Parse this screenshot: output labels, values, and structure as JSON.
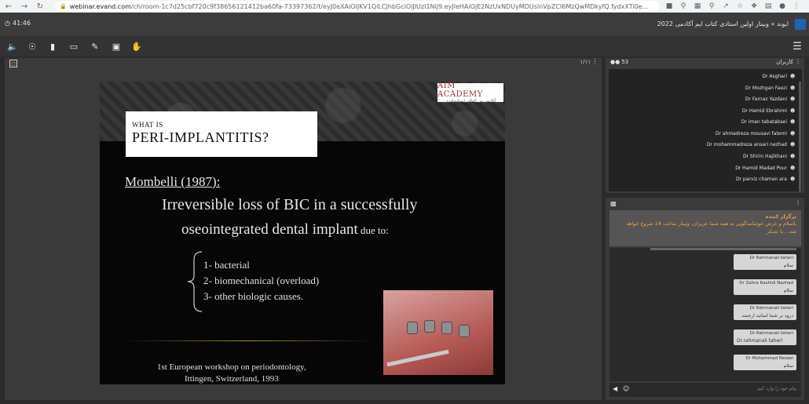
{
  "browser": {
    "url_host": "webinar.evand.com",
    "url_rest": "/ch/room-1c7d25cbf720c9f38656121412ba60fa-73397362/t/eyJ0eXAiOiJKV1QiLCJhbGciOiJIUzI1NiJ9.eyJleHAiOjE2NzUxNDUyMDUsInVpZCI6MzQwMDkyfQ.fydxXTi0e..."
  },
  "header": {
    "timer": "41:46",
    "title": "ایوند » وبینار اولین استادی کتاب ایم آکادمی 2022"
  },
  "stage": {
    "page_num": "۱/۱۱"
  },
  "slide": {
    "logo_name": "AIM ACADEMY",
    "logo_sub": "آکادمی بین المللی ایمپلنتولوژی",
    "title_small": "WHAT IS",
    "title_big": "PERI-IMPLANTITIS?",
    "author": "Mombelli (1987):",
    "line1": "Irreversible loss of BIC in a successfully",
    "line2": "oseointegrated dental implant",
    "line2_suffix": " due to:",
    "causes": [
      "1- bacterial",
      "2- biomechanical (overload)",
      "3- other biologic causes."
    ],
    "ref1": "1st European workshop on periodontology,",
    "ref2": "Ittingen, Switzerland, 1993"
  },
  "users": {
    "count": "53",
    "title": "کاربران",
    "list": [
      "Dr Asghari",
      "Dr Mozhgan Faezi",
      "Dr Farnaz Yazdani",
      "Dr Hamid Ebrahimi",
      "Dr iman tabatabaei",
      "Dr ahmadreza mousavi fatemi",
      "Dr mohammadreza ansari nezhad",
      "Dr Shirin Hajikhani",
      "Dr Hamid Madad Pour",
      "Dr parviz chaman ara"
    ]
  },
  "chat": {
    "notice_title": "برگزار کننده",
    "notice_body": "باسلام و عرض خوشامدگویی به همه شما عزیزان، وبینار ساعت 14 شروع خواهد شد... با تشکر",
    "messages": [
      {
        "name": "Dr Rahmanali taheri",
        "text": "سلام"
      },
      {
        "name": "Dr Zahra Rashidi Nezhad",
        "text": "سلام"
      },
      {
        "name": "Dr Rahmanali taheri",
        "text": "درود بر شما اساتید ارجمند"
      },
      {
        "name": "Dr Rahmanali taheri",
        "text": "Dr.rahmanali taheri"
      },
      {
        "name": "Dr Mohammad Rezaei",
        "text": "سلام"
      }
    ],
    "placeholder": "پیام خود را وارد کنید"
  },
  "colors": {
    "notice_text": "#f2a23a",
    "app_bg": "#3c3c3c"
  }
}
